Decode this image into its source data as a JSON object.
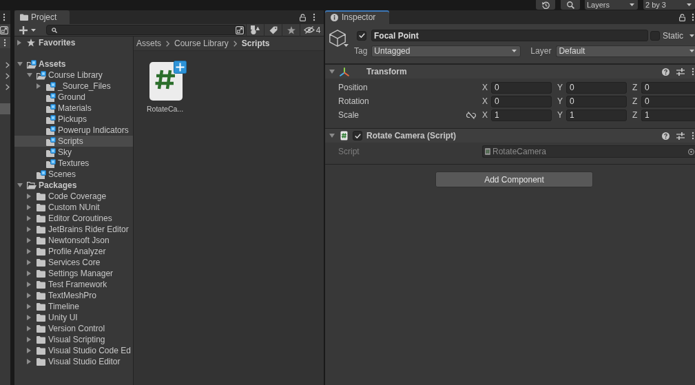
{
  "toolbar": {
    "layers_dropdown": "Layers",
    "layout_dropdown": "2 by 3"
  },
  "left_panel": {
    "rows": [
      {
        "expanded": false,
        "selected": false
      },
      {
        "expanded": false,
        "selected": false
      },
      {
        "expanded": false,
        "selected": false
      },
      {
        "selected": false
      },
      {
        "selected": true
      }
    ]
  },
  "project": {
    "tab": {
      "label": "Project",
      "selected": true,
      "focused": false
    },
    "hidden_packages_count": "4",
    "tree": [
      {
        "label": "Favorites",
        "kind": "favorites",
        "expanded": false,
        "selected": false
      },
      {
        "label": "Assets",
        "kind": "asset",
        "expanded": true,
        "selected": false,
        "children": [
          {
            "label": "Course Library",
            "kind": "asset",
            "expanded": true,
            "selected": false,
            "children": [
              {
                "label": "_Source_Files",
                "kind": "asset",
                "expanded": false,
                "selected": false
              },
              {
                "label": "Ground",
                "kind": "asset",
                "selected": false
              },
              {
                "label": "Materials",
                "kind": "asset",
                "selected": false
              },
              {
                "label": "Pickups",
                "kind": "asset",
                "selected": false
              },
              {
                "label": "Powerup Indicators",
                "kind": "asset",
                "selected": false
              },
              {
                "label": "Scripts",
                "kind": "asset",
                "selected": true
              },
              {
                "label": "Sky",
                "kind": "asset",
                "selected": false
              },
              {
                "label": "Textures",
                "kind": "asset",
                "selected": false
              }
            ]
          },
          {
            "label": "Scenes",
            "kind": "asset",
            "selected": false
          }
        ]
      },
      {
        "label": "Packages",
        "kind": "package",
        "expanded": true,
        "selected": false,
        "children": [
          {
            "label": "Code Coverage",
            "kind": "package",
            "expanded": false,
            "selected": false
          },
          {
            "label": "Custom NUnit",
            "kind": "package",
            "expanded": false,
            "selected": false
          },
          {
            "label": "Editor Coroutines",
            "kind": "package",
            "expanded": false,
            "selected": false
          },
          {
            "label": "JetBrains Rider Editor",
            "kind": "package",
            "expanded": false,
            "selected": false
          },
          {
            "label": "Newtonsoft Json",
            "kind": "package",
            "expanded": false,
            "selected": false
          },
          {
            "label": "Profile Analyzer",
            "kind": "package",
            "expanded": false,
            "selected": false
          },
          {
            "label": "Services Core",
            "kind": "package",
            "expanded": false,
            "selected": false
          },
          {
            "label": "Settings Manager",
            "kind": "package",
            "expanded": false,
            "selected": false
          },
          {
            "label": "Test Framework",
            "kind": "package",
            "expanded": false,
            "selected": false
          },
          {
            "label": "TextMeshPro",
            "kind": "package",
            "expanded": false,
            "selected": false
          },
          {
            "label": "Timeline",
            "kind": "package",
            "expanded": false,
            "selected": false
          },
          {
            "label": "Unity UI",
            "kind": "package",
            "expanded": false,
            "selected": false
          },
          {
            "label": "Version Control",
            "kind": "package",
            "expanded": false,
            "selected": false
          },
          {
            "label": "Visual Scripting",
            "kind": "package",
            "expanded": false,
            "selected": false
          },
          {
            "label": "Visual Studio Code Ed",
            "kind": "package",
            "expanded": false,
            "selected": false
          },
          {
            "label": "Visual Studio Editor",
            "kind": "package",
            "expanded": false,
            "selected": false
          }
        ]
      }
    ],
    "breadcrumb": [
      {
        "label": "Assets",
        "current": false
      },
      {
        "label": "Course Library",
        "current": false
      },
      {
        "label": "Scripts",
        "current": true
      }
    ],
    "assets": [
      {
        "label": "RotateCa...",
        "kind": "script",
        "new": true
      }
    ]
  },
  "inspector": {
    "tab": {
      "label": "Inspector",
      "selected": true,
      "focused": true
    },
    "object": {
      "active": true,
      "name": "Focal Point",
      "static": false,
      "static_label": "Static",
      "tag_label": "Tag",
      "tag": "Untagged",
      "layer_label": "Layer",
      "layer": "Default"
    },
    "components": [
      {
        "kind": "transform",
        "title": "Transform",
        "expanded": true,
        "properties": [
          {
            "label": "Position",
            "values": [
              {
                "axis": "X",
                "value": "0"
              },
              {
                "axis": "Y",
                "value": "0"
              },
              {
                "axis": "Z",
                "value": "0"
              }
            ]
          },
          {
            "label": "Rotation",
            "values": [
              {
                "axis": "X",
                "value": "0"
              },
              {
                "axis": "Y",
                "value": "0"
              },
              {
                "axis": "Z",
                "value": "0"
              }
            ]
          },
          {
            "label": "Scale",
            "constrained": false,
            "values": [
              {
                "axis": "X",
                "value": "1"
              },
              {
                "axis": "Y",
                "value": "1"
              },
              {
                "axis": "Z",
                "value": "1"
              }
            ]
          }
        ]
      },
      {
        "kind": "script",
        "title": "Rotate Camera (Script)",
        "enabled": true,
        "expanded": true,
        "fields": [
          {
            "label": "Script",
            "value": "RotateCamera",
            "disabled": true
          }
        ]
      }
    ],
    "add_component_button": "Add Component"
  }
}
